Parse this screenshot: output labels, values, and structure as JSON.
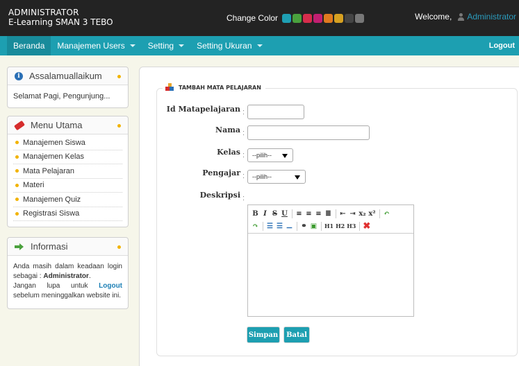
{
  "header": {
    "role": "ADMINISTRATOR",
    "site": "E-Learning SMAN 3 TEBO",
    "change_color_label": "Change Color",
    "swatches": [
      "#1e9fb3",
      "#4aa13d",
      "#d62d4c",
      "#c21f71",
      "#e07a1f",
      "#d6a021",
      "#444444",
      "#777777"
    ],
    "welcome": "Welcome,",
    "user": "Administrator"
  },
  "nav": {
    "items": [
      {
        "label": "Beranda"
      },
      {
        "label": "Manajemen Users"
      },
      {
        "label": "Setting"
      },
      {
        "label": "Setting Ukuran"
      }
    ],
    "logout": "Logout"
  },
  "sidebar": {
    "greeting": {
      "title": "Assalamuallaikum",
      "text": "Selamat Pagi, Pengunjung..."
    },
    "menu": {
      "title": "Menu Utama",
      "items": [
        "Manajemen Siswa",
        "Manajemen Kelas",
        "Mata Pelajaran",
        "Materi",
        "Manajemen Quiz",
        "Registrasi Siswa"
      ]
    },
    "info": {
      "title": "Informasi",
      "line1": "Anda masih dalam keadaan login sebagai :",
      "user": "Administrator",
      "line2a": "Jangan lupa untuk",
      "logout": "Logout",
      "line2b": "sebelum meninggalkan website ini."
    }
  },
  "form": {
    "legend": "TAMBAH MATA PELAJARAN",
    "fields": {
      "id": {
        "label": "Id Matapelajaran",
        "value": ""
      },
      "nama": {
        "label": "Nama",
        "value": ""
      },
      "kelas": {
        "label": "Kelas",
        "selected": "--pilih--"
      },
      "pengajar": {
        "label": "Pengajar",
        "selected": "--pilih--"
      },
      "deskripsi": {
        "label": "Deskripsi",
        "value": ""
      }
    },
    "colon": ":",
    "editor_toolbar": {
      "row1": [
        "B",
        "I",
        "S",
        "U",
        "|",
        "align-left",
        "align-center",
        "align-right",
        "align-justify",
        "|",
        "outdent",
        "indent",
        "x₂",
        "x²",
        "|",
        "undo"
      ],
      "row2": [
        "redo",
        "|",
        "ordered-list",
        "unordered-list",
        "horizontal-rule",
        "|",
        "link",
        "image",
        "|",
        "H1",
        "H2",
        "H3",
        "|",
        "remove-format"
      ]
    },
    "save_label": "Simpan",
    "cancel_label": "Batal"
  }
}
